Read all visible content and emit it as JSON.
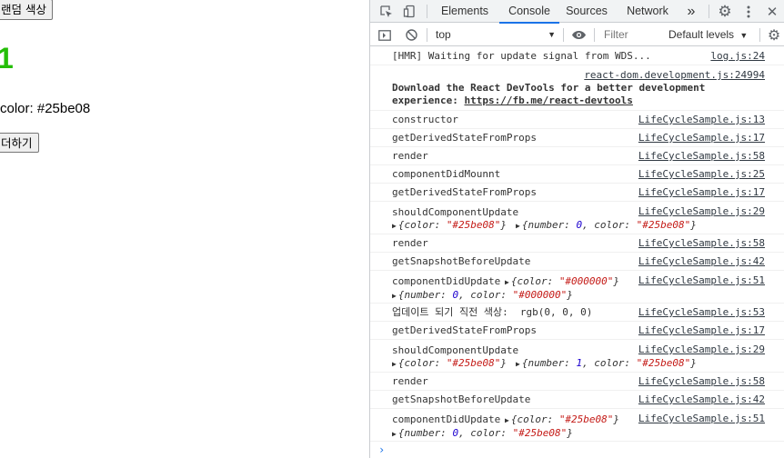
{
  "page": {
    "random_button": "랜덤 색상",
    "number": "1",
    "color_text": "color: #25be08",
    "add_button": "더하기",
    "number_color": "#25be08"
  },
  "devtools": {
    "tabs": [
      "Elements",
      "Console",
      "Sources",
      "Network"
    ],
    "more": "»",
    "active_tab": "Console",
    "context": "top",
    "filter_placeholder": "Filter",
    "levels": "Default levels",
    "accent": "#1a73e8"
  },
  "console": {
    "hmr": {
      "text": "[HMR] Waiting for update signal from WDS...",
      "src": "log.js:24"
    },
    "devtools_msg": {
      "src": "react-dom.development.js:24994",
      "line1": "Download the React DevTools for a better development",
      "line2_prefix": "experience: ",
      "link": "https://fb.me/react-devtools"
    },
    "messages": [
      {
        "text": "constructor",
        "src": "LifeCycleSample.js:13"
      },
      {
        "text": "getDerivedStateFromProps",
        "src": "LifeCycleSample.js:17"
      },
      {
        "text": "render",
        "src": "LifeCycleSample.js:58"
      },
      {
        "text": "componentDidMounnt",
        "src": "LifeCycleSample.js:25"
      },
      {
        "text": "getDerivedStateFromProps",
        "src": "LifeCycleSample.js:17"
      },
      {
        "text": "shouldComponentUpdate",
        "src": "LifeCycleSample.js:29",
        "objs": [
          "{color: \"#25be08\"}",
          "{number: 0, color: \"#25be08\"}"
        ]
      },
      {
        "text": "render",
        "src": "LifeCycleSample.js:58"
      },
      {
        "text": "getSnapshotBeforeUpdate",
        "src": "LifeCycleSample.js:42"
      },
      {
        "text": "componentDidUpdate",
        "src": "LifeCycleSample.js:51",
        "objs": [
          "{color: \"#000000\"}",
          "{number: 0, color: \"#000000\"}"
        ]
      },
      {
        "text": "업데이트 되기 직전 색상:  rgb(0, 0, 0)",
        "src": "LifeCycleSample.js:53"
      },
      {
        "text": "getDerivedStateFromProps",
        "src": "LifeCycleSample.js:17"
      },
      {
        "text": "shouldComponentUpdate",
        "src": "LifeCycleSample.js:29",
        "objs": [
          "{color: \"#25be08\"}",
          "{number: 1, color: \"#25be08\"}"
        ]
      },
      {
        "text": "render",
        "src": "LifeCycleSample.js:58"
      },
      {
        "text": "getSnapshotBeforeUpdate",
        "src": "LifeCycleSample.js:42"
      },
      {
        "text": "componentDidUpdate",
        "src": "LifeCycleSample.js:51",
        "objs": [
          "{color: \"#25be08\"}",
          "{number: 0, color: \"#25be08\"}"
        ]
      }
    ],
    "prompt": "›"
  }
}
